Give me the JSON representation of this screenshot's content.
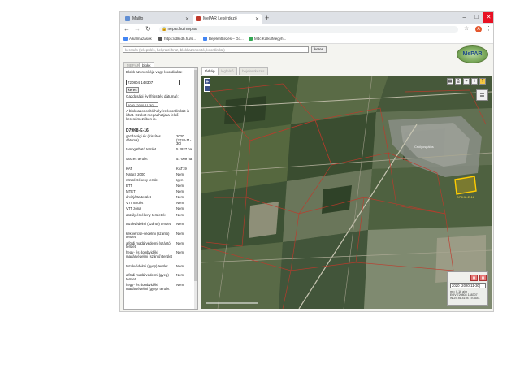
{
  "browser": {
    "tabs": [
      {
        "label": "Mailto",
        "favicon_color": "#5f8dd3",
        "active": false
      },
      {
        "label": "MePAR Lekérdező",
        "favicon_color": "#c0392b",
        "active": true
      }
    ],
    "new_tab": "+",
    "window_controls": {
      "minimize": "–",
      "maximize": "□",
      "close": "✕"
    },
    "address": "mepar.hu/mepar/",
    "profile_initial": "A",
    "bookmarks": [
      {
        "label": "Alkalmazások",
        "color": "#4285f4"
      },
      {
        "label": "https://dlk.dh.hu/s...",
        "color": "#555555"
      },
      {
        "label": "Bejelentkezés – Go...",
        "color": "#4285f4"
      },
      {
        "label": "Mdc KalkulMegyh...",
        "color": "#34a853"
      }
    ]
  },
  "app": {
    "search_placeholder": "keresés (település, helyrajzi hrsz, blokkazonosító, koordináta)",
    "search_button": "keres",
    "logo_text": "MePAR",
    "panel_tabs": [
      "MEPÁR",
      "blokk"
    ],
    "map_tabs": [
      "térkép",
      "legfelső",
      "bejelentkezés"
    ],
    "left": {
      "label_search": "Blokk azonosítója vagy koordináta:",
      "input_value": "720804 148307",
      "search_button": "keres",
      "label_year": "Gazdasági év (frissítés dátuma):",
      "year_value": "2020 (2020-11-30)",
      "info_text": "A blokkazonosító helyére koordinátát is írhat. Ezeket megadhatja a felső keresőmezőben is.",
      "block_id": "D79K8-E-16",
      "properties": [
        {
          "key": "gazdasági év (frissítés dátuma)",
          "value": "2020 (2020-11-30)"
        },
        {
          "key": "támogatható terület",
          "value": "5.2927 ha"
        },
        {
          "key": "összes terület",
          "value": "5.7009 ha"
        },
        {
          "key": "KAT",
          "value": "KAT19"
        },
        {
          "key": "Natura 2000",
          "value": "Nem"
        },
        {
          "key": "nitrátérzékeny terület",
          "value": "Igen"
        },
        {
          "key": "ÉTT",
          "value": "Nem"
        },
        {
          "key": "MTET",
          "value": "Nem"
        },
        {
          "key": "árvízjárta terület",
          "value": "Nem"
        },
        {
          "key": "VTT terület",
          "value": "Nem"
        },
        {
          "key": "VTT zóna",
          "value": "Nem"
        },
        {
          "key": "aszály érzékeny területek",
          "value": "Nem"
        },
        {
          "key": "túzokvédelmi (szántó) terület",
          "value": "Nem"
        },
        {
          "key": "kék vércse-védelmi (szántó) terület",
          "value": "Nem"
        },
        {
          "key": "alföldi madárvédelmi (szántó) terület",
          "value": "Nem"
        },
        {
          "key": "hegy- és dombvidéki madárvédelmi (szántó) terület",
          "value": "Nem"
        },
        {
          "key": "túzokvédelmi (gyep) terület",
          "value": "Nem"
        },
        {
          "key": "alföldi madárvédelmi (gyep) terület",
          "value": "Nem"
        },
        {
          "key": "hegy- és dombvidéki madárvédelmi (gyep) terület",
          "value": "Nem"
        }
      ]
    },
    "map": {
      "zoom_in": "+",
      "zoom_out": "−",
      "selected_block_label": "D79K8-E-16",
      "settlement_label": "Csólyospálos",
      "year_value": "2020 (2020-11-30)",
      "scale_text": "m = 0.16 a/m",
      "coord_lines": [
        "EOV 720804 148307",
        "WGS 46.4194 19.8541"
      ]
    }
  }
}
